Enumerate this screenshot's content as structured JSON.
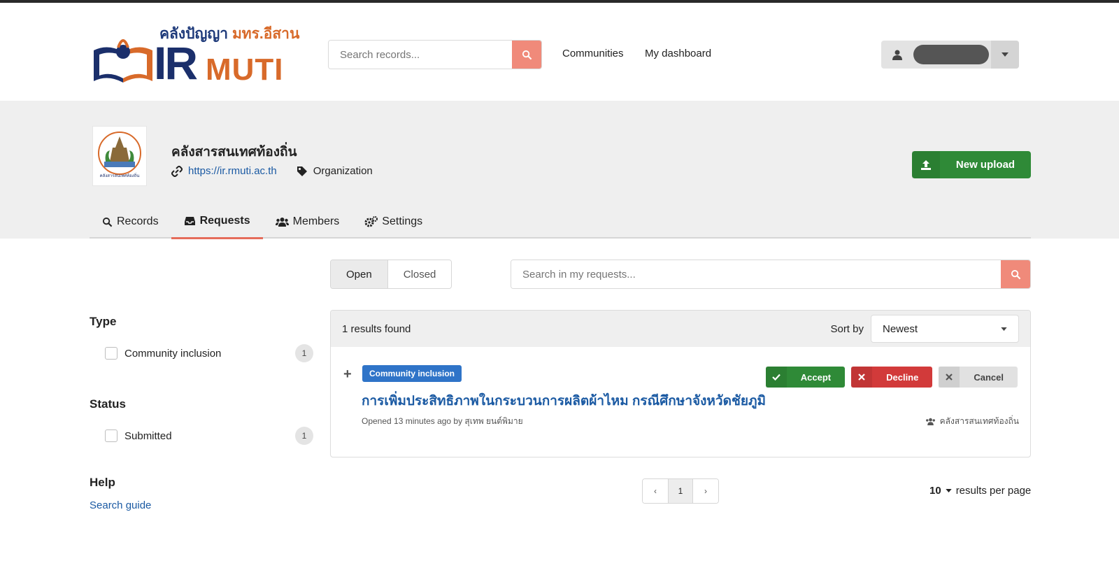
{
  "header": {
    "logo_thai_a": "คลังปัญญา",
    "logo_thai_b": "มทร.อีสาน",
    "logo_ir": "IR",
    "logo_muti": "MUTI",
    "search_placeholder": "Search records...",
    "nav": [
      "Communities",
      "My dashboard"
    ]
  },
  "community": {
    "title": "คลังสารสนเทศท้องถิ่น",
    "url": "https://ir.rmuti.ac.th",
    "type": "Organization",
    "upload_label": "New upload",
    "logo_caption": "คลังสารสนเทศท้องถิ่น"
  },
  "tabs": [
    {
      "label": "Records",
      "icon": "search-icon"
    },
    {
      "label": "Requests",
      "icon": "inbox-icon"
    },
    {
      "label": "Members",
      "icon": "users-icon"
    },
    {
      "label": "Settings",
      "icon": "cogs-icon"
    }
  ],
  "filters": {
    "type_title": "Type",
    "type_item": "Community inclusion",
    "type_count": "1",
    "status_title": "Status",
    "status_item": "Submitted",
    "status_count": "1",
    "help_title": "Help",
    "help_link": "Search guide"
  },
  "requests": {
    "toggle_open": "Open",
    "toggle_closed": "Closed",
    "search_placeholder": "Search in my requests...",
    "results_found": "1 results found",
    "sort_label": "Sort by",
    "sort_value": "Newest",
    "item": {
      "badge": "Community inclusion",
      "title": "การเพิ่มประสิทธิภาพในกระบวนการผลิตผ้าไหม กรณีศึกษาจังหวัดชัยภูมิ",
      "meta": "Opened 13 minutes ago by สุเทพ ยนต์พิมาย",
      "owner": "คลังสารสนเทศท้องถิ่น",
      "accept": "Accept",
      "decline": "Decline",
      "cancel": "Cancel"
    }
  },
  "pagination": {
    "prev": "‹",
    "page": "1",
    "next": "›",
    "per_page_value": "10",
    "per_page_label": "results per page"
  },
  "colors": {
    "accent": "#f08a7a",
    "success": "#2f8a37",
    "danger": "#d23a3a",
    "link": "#1b5aa3",
    "badge": "#2f74c8"
  }
}
